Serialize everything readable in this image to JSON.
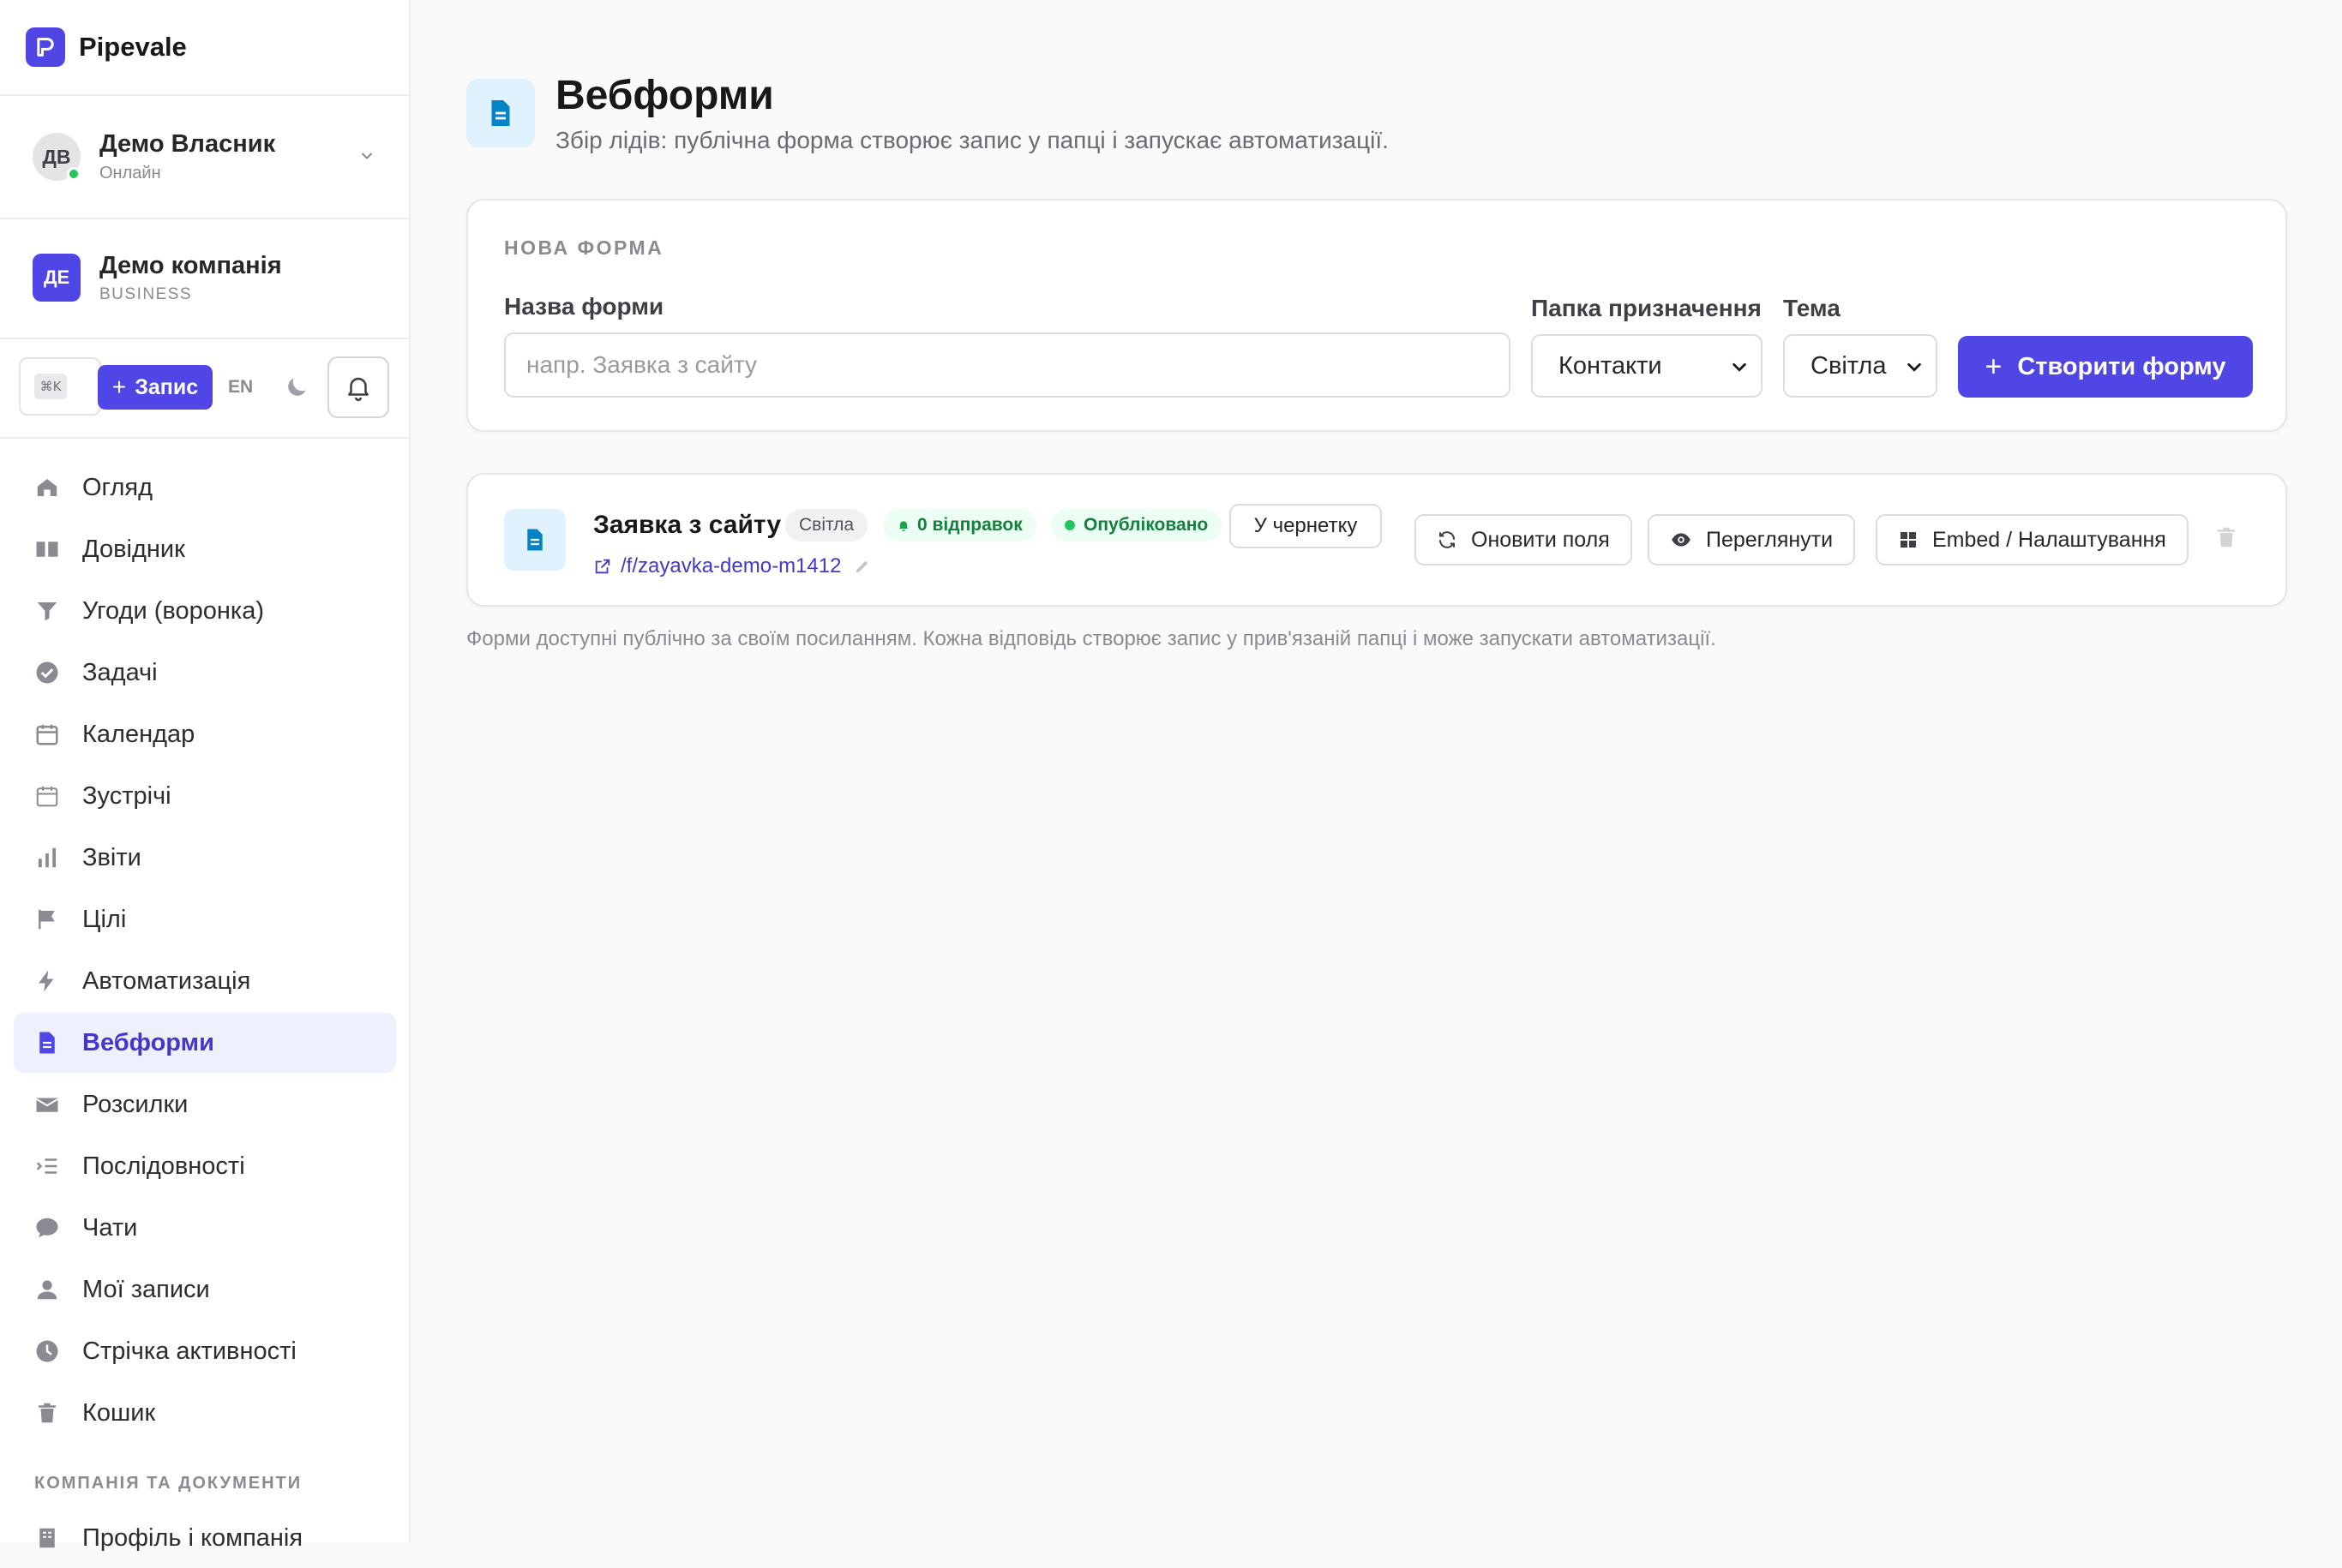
{
  "app": {
    "name": "Pipevale",
    "accent": "#4f46e5"
  },
  "user": {
    "initials": "ДВ",
    "name": "Демо Власник",
    "status": "Онлайн"
  },
  "company": {
    "initials": "ДЕ",
    "name": "Демо компанія",
    "plan": "BUSINESS"
  },
  "quick": {
    "shortcut": "⌘K",
    "add_label": "Запис",
    "lang": "EN"
  },
  "nav": {
    "items": [
      {
        "label": "Огляд",
        "icon": "home-icon"
      },
      {
        "label": "Довідник",
        "icon": "book-icon"
      },
      {
        "label": "Угоди (воронка)",
        "icon": "funnel-icon"
      },
      {
        "label": "Задачі",
        "icon": "check-circle-icon"
      },
      {
        "label": "Календар",
        "icon": "calendar-icon"
      },
      {
        "label": "Зустрічі",
        "icon": "calendar-outline-icon"
      },
      {
        "label": "Звіти",
        "icon": "bar-chart-icon"
      },
      {
        "label": "Цілі",
        "icon": "flag-icon"
      },
      {
        "label": "Автоматизація",
        "icon": "bolt-icon"
      },
      {
        "label": "Вебформи",
        "icon": "document-icon",
        "active": true
      },
      {
        "label": "Розсилки",
        "icon": "envelope-icon"
      },
      {
        "label": "Послідовності",
        "icon": "list-indent-icon"
      },
      {
        "label": "Чати",
        "icon": "chat-bubble-icon"
      },
      {
        "label": "Мої записи",
        "icon": "user-icon"
      },
      {
        "label": "Стрічка активності",
        "icon": "clock-icon"
      },
      {
        "label": "Кошик",
        "icon": "trash-icon"
      }
    ],
    "section_title": "КОМПАНІЯ ТА ДОКУМЕНТИ",
    "section_items": [
      {
        "label": "Профіль і компанія",
        "icon": "building-icon"
      }
    ]
  },
  "page": {
    "title": "Вебформи",
    "subtitle": "Збір лідів: публічна форма створює запис у папці і запускає автоматизації."
  },
  "new_form": {
    "overline": "НОВА ФОРМА",
    "name_label": "Назва форми",
    "name_placeholder": "напр. Заявка з сайту",
    "name_value": "",
    "folder_label": "Папка призначення",
    "folder_value": "Контакти",
    "theme_label": "Тема",
    "theme_value": "Світла",
    "create_label": "Створити форму"
  },
  "forms": [
    {
      "name": "Заявка з сайту",
      "theme": "Світла",
      "submissions": "0 відправок",
      "status": "Опубліковано",
      "draft_label": "У чернетку",
      "link": "/f/zayavka-demo-m1412",
      "refresh_label": "Оновити поля",
      "preview_label": "Переглянути",
      "embed_label": "Embed / Налаштування"
    }
  ],
  "hint": "Форми доступні публічно за своїм посиланням. Кожна відповідь створює запис у прив'язаній папці і може запускати автоматизації."
}
